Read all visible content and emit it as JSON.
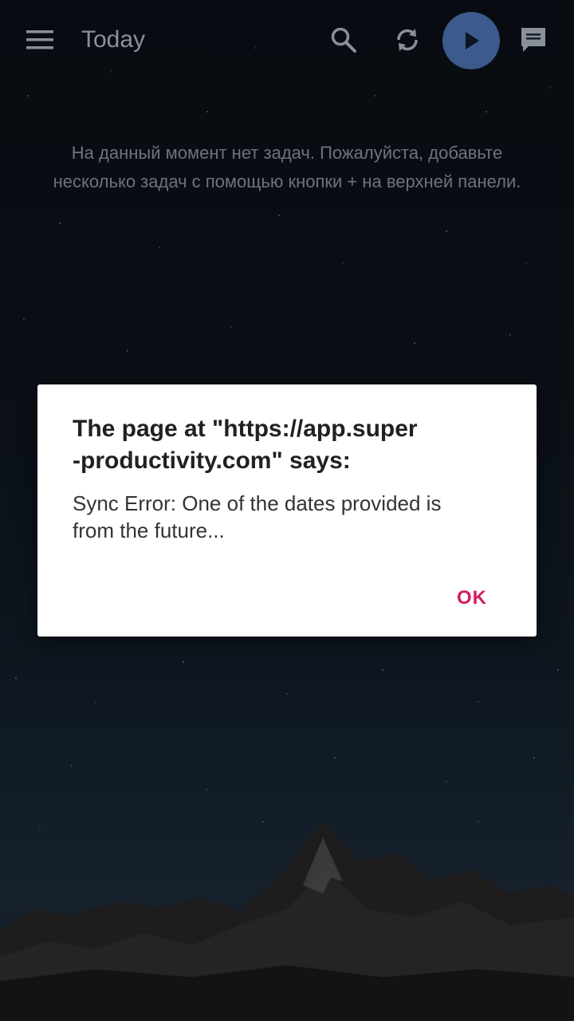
{
  "header": {
    "title": "Today"
  },
  "icons": {
    "menu": "menu-icon",
    "search": "search-icon",
    "sync": "sync-icon",
    "play": "play-icon",
    "chat": "chat-icon"
  },
  "empty_state": {
    "line1": "На данный момент нет задач. Пожалуйста, добавьте",
    "line2": "несколько задач с помощью кнопки + на верхней панели."
  },
  "dialog": {
    "title_line1": "The page at \"https://app.super",
    "title_line2": "-productivity.com\" says:",
    "message_line1": "Sync Error: One of the dates provided is",
    "message_line2": "from the future...",
    "ok_label": "OK"
  },
  "colors": {
    "accent": "#d81b60",
    "play_button": "#3c5a8c"
  }
}
